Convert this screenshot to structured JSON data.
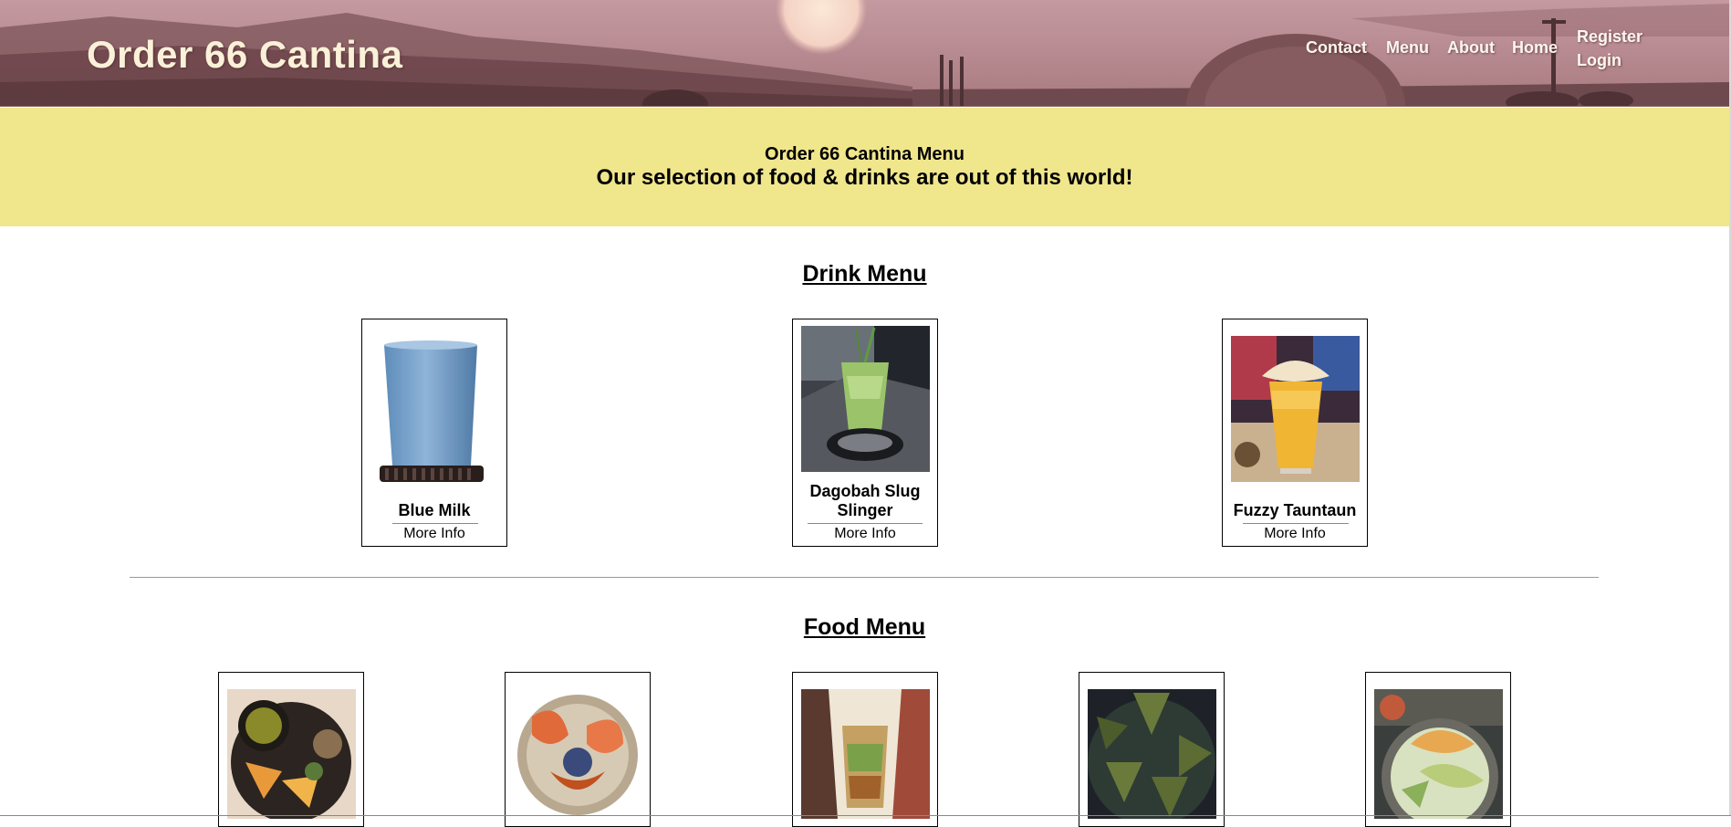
{
  "header": {
    "brand": "Order 66 Cantina",
    "nav": {
      "contact": "Contact",
      "menu": "Menu",
      "about": "About",
      "home": "Home",
      "register": "Register",
      "login": "Login"
    }
  },
  "banner": {
    "title": "Order 66 Cantina Menu",
    "subtitle": "Our selection of food & drinks are out of this world!"
  },
  "drink_menu": {
    "heading": "Drink Menu",
    "items": [
      {
        "name": "Blue Milk",
        "more": "More Info",
        "image_icon": "blue-milk-glass-icon"
      },
      {
        "name": "Dagobah Slug Slinger",
        "more": "More Info",
        "image_icon": "green-cocktail-icon"
      },
      {
        "name": "Fuzzy Tauntaun",
        "more": "More Info",
        "image_icon": "yellow-beer-glass-icon"
      }
    ]
  },
  "food_menu": {
    "heading": "Food Menu",
    "items": [
      {
        "image_icon": "food-platter-icon"
      },
      {
        "image_icon": "crab-dish-icon"
      },
      {
        "image_icon": "wrap-sandwich-icon"
      },
      {
        "image_icon": "triangle-crackers-icon"
      },
      {
        "image_icon": "salad-bowl-icon"
      }
    ]
  },
  "colors": {
    "banner": "#f0e68c",
    "header_text": "#fbf0d8"
  }
}
